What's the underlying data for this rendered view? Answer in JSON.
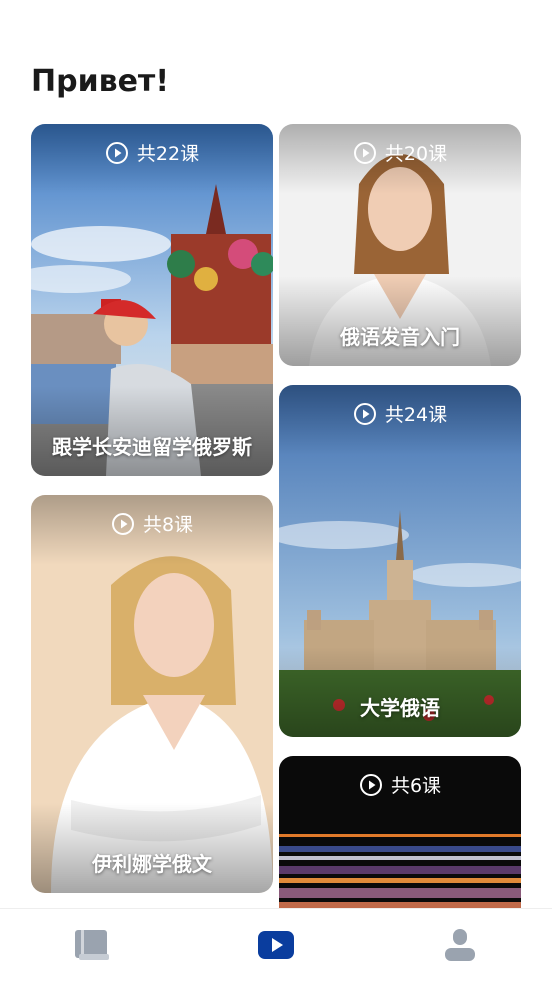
{
  "header": {
    "greeting": "Привет!"
  },
  "courses": [
    {
      "count": "共22课",
      "title": "跟学长安迪留学俄罗斯",
      "image": "moscow-kremlin-cathedral-girl-painting"
    },
    {
      "count": "共20课",
      "title": "俄语发音入门",
      "image": "smiling-woman-white-shirt"
    },
    {
      "count": "共24课",
      "title": "大学俄语",
      "image": "moscow-state-university-building"
    },
    {
      "count": "共8课",
      "title": "伊利娜学俄文",
      "image": "blonde-woman-arms-crossed"
    },
    {
      "count": "共6课",
      "title": "",
      "image": "dark-light-streaks"
    }
  ],
  "tabbar": {
    "items": [
      {
        "icon": "book-icon",
        "active": false
      },
      {
        "icon": "play-icon",
        "active": true
      },
      {
        "icon": "profile-icon",
        "active": false
      }
    ]
  },
  "colors": {
    "accent": "#0a3d9e",
    "inactive": "#9aa3af",
    "text": "#1a1a1a"
  }
}
